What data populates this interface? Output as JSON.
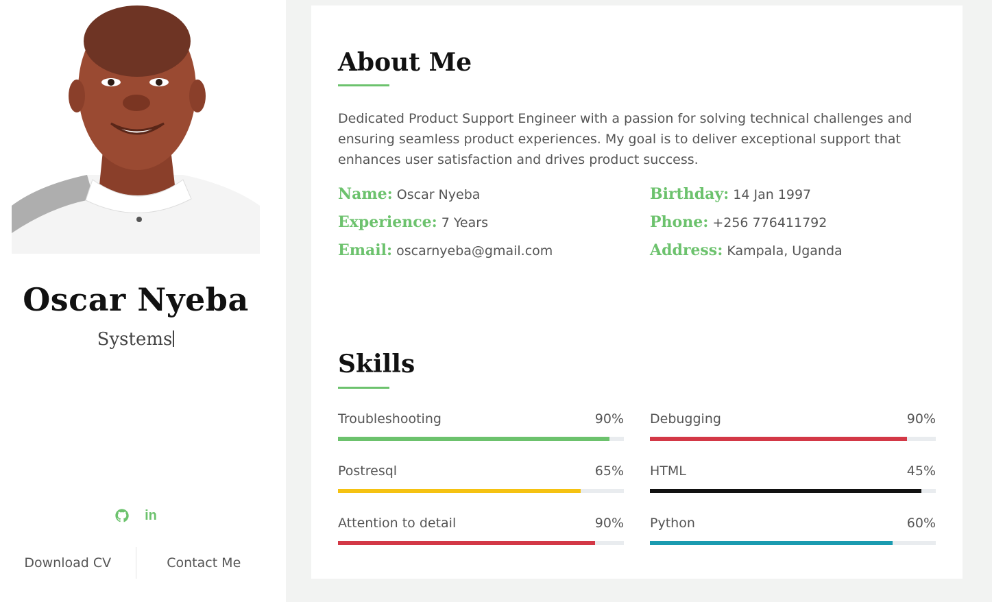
{
  "sidebar": {
    "name": "Oscar Nyeba",
    "typed_text": "Systems",
    "social": [
      {
        "icon": "github-icon"
      },
      {
        "icon": "linkedin-icon",
        "glyph": "in"
      }
    ],
    "buttons": {
      "download_cv": "Download CV",
      "contact_me": "Contact Me"
    }
  },
  "about": {
    "title": "About Me",
    "description": "Dedicated Product Support Engineer with a passion for solving technical challenges and ensuring seamless product experiences. My goal is to deliver exceptional support that enhances user satisfaction and drives product success.",
    "info": {
      "name_label": "Name:",
      "name_value": "Oscar Nyeba",
      "experience_label": "Experience:",
      "experience_value": "7 Years",
      "email_label": "Email:",
      "email_value": "oscarnyeba@gmail.com",
      "birthday_label": "Birthday:",
      "birthday_value": "14 Jan 1997",
      "phone_label": "Phone:",
      "phone_value": "+256 776411792",
      "address_label": "Address:",
      "address_value": "Kampala, Uganda"
    }
  },
  "skills": {
    "title": "Skills",
    "items": [
      {
        "label": "Troubleshooting",
        "percent_text": "90%",
        "progress": 0.95,
        "color": "#6cc26d"
      },
      {
        "label": "Debugging",
        "percent_text": "90%",
        "progress": 0.9,
        "color": "#d33846"
      },
      {
        "label": "Postresql",
        "percent_text": "65%",
        "progress": 0.85,
        "color": "#f5c211"
      },
      {
        "label": "HTML",
        "percent_text": "45%",
        "progress": 0.95,
        "color": "#111111"
      },
      {
        "label": "Attention to detail",
        "percent_text": "90%",
        "progress": 0.9,
        "color": "#d33846"
      },
      {
        "label": "Python",
        "percent_text": "60%",
        "progress": 0.85,
        "color": "#1a9bb0"
      }
    ]
  },
  "colors": {
    "accent": "#6cc26d",
    "background": "#f2f3f2"
  }
}
